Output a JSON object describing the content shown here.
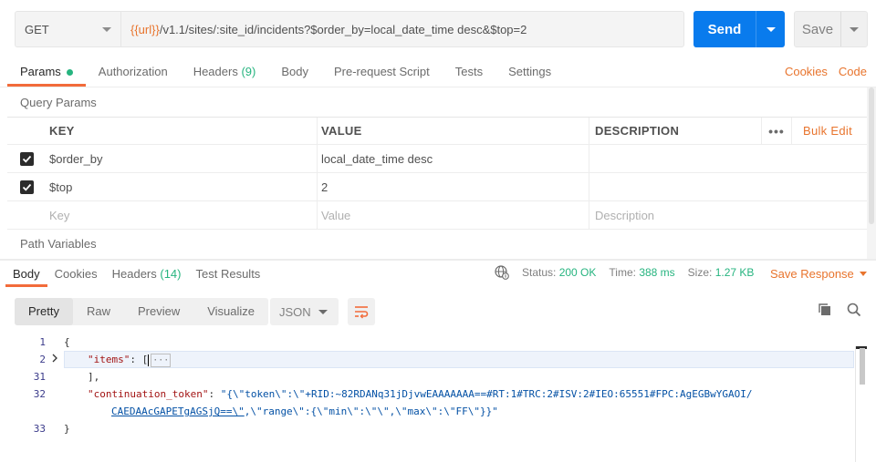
{
  "request": {
    "method": "GET",
    "url_var": "{{url}}",
    "url_rest": "/v1.1/sites/:site_id/incidents?$order_by=local_date_time desc&$top=2",
    "send_label": "Send",
    "save_label": "Save"
  },
  "req_tabs": [
    {
      "label": "Params"
    },
    {
      "label": "Authorization"
    },
    {
      "label": "Headers",
      "count": "(9)"
    },
    {
      "label": "Body"
    },
    {
      "label": "Pre-request Script"
    },
    {
      "label": "Tests"
    },
    {
      "label": "Settings"
    }
  ],
  "req_links": {
    "cookies": "Cookies",
    "code": "Code"
  },
  "query_params": {
    "title": "Query Params",
    "headers": {
      "key": "KEY",
      "value": "VALUE",
      "description": "DESCRIPTION",
      "more": "•••",
      "bulk_edit": "Bulk Edit"
    },
    "rows": [
      {
        "key": "$order_by",
        "value": "local_date_time desc",
        "description": "",
        "checked": true
      },
      {
        "key": "$top",
        "value": "2",
        "description": "",
        "checked": true
      }
    ],
    "placeholder": {
      "key": "Key",
      "value": "Value",
      "description": "Description"
    }
  },
  "path_variables": {
    "title": "Path Variables"
  },
  "resp_tabs": [
    {
      "label": "Body"
    },
    {
      "label": "Cookies"
    },
    {
      "label": "Headers",
      "count": "(14)"
    },
    {
      "label": "Test Results"
    }
  ],
  "resp_meta": {
    "status_label": "Status:",
    "status_value": "200 OK",
    "time_label": "Time:",
    "time_value": "388 ms",
    "size_label": "Size:",
    "size_value": "1.27 KB",
    "save_response": "Save Response"
  },
  "view_modes": [
    "Pretty",
    "Raw",
    "Preview",
    "Visualize"
  ],
  "format": "JSON",
  "code": {
    "lines": [
      {
        "num": "1",
        "text": "{"
      },
      {
        "num": "2",
        "key": "\"items\"",
        "colon": ": ",
        "bracket": "[",
        "fold": "···"
      },
      {
        "num": "31",
        "text": "],"
      },
      {
        "num": "32",
        "key": "\"continuation_token\"",
        "colon": ": ",
        "value_a": "\"{\\\"token\\\":\\\"+RID:~82RDANq31jDjvwEAAAAAAA==#RT:1#TRC:2#ISV:2#IEO:65551#FPC:AgEGBwYGAOI/"
      },
      {
        "num": "",
        "value_b": "CAEDAAcGAPETgAGSjQ==\\\"",
        "value_c": ",\\\"range\\\":{\\\"min\\\":\\\"\\\",\\\"max\\\":\\\"FF\\\"}}\""
      },
      {
        "num": "33",
        "text": "}"
      }
    ]
  }
}
